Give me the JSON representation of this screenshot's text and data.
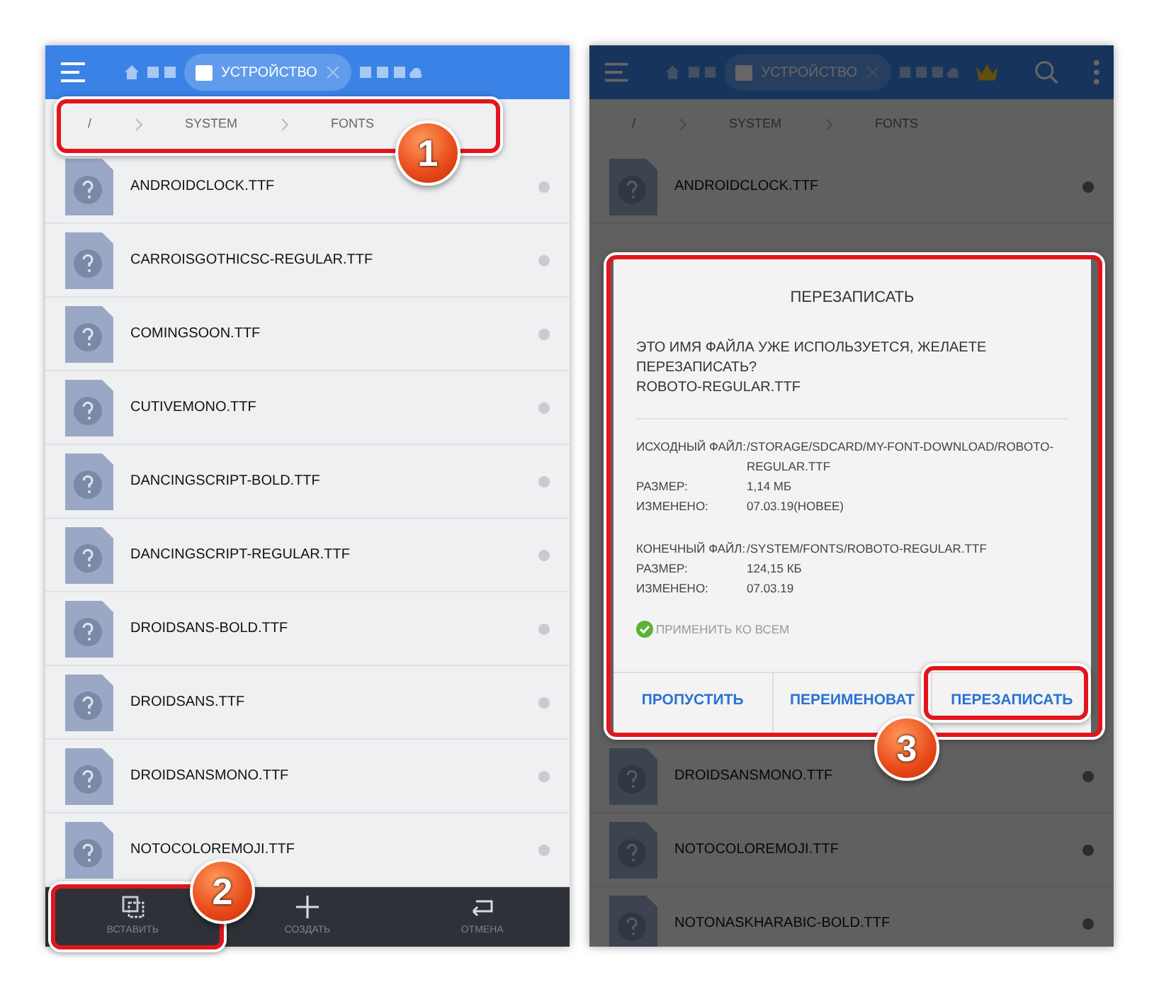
{
  "screens": [
    {
      "dimmed": false,
      "top_bar": {
        "tab": "УСТРОЙСТВО",
        "action_icons": false
      },
      "breadcrumb": [
        "/",
        "SYSTEM",
        "FONTS"
      ],
      "files_above": [
        "ANDROIDCLOCK.TTF",
        "CARROISGOTHICSC-REGULAR.TTF",
        "COMINGSOON.TTF",
        "CUTIVEMONO.TTF",
        "DANCINGSCRIPT-BOLD.TTF",
        "DANCINGSCRIPT-REGULAR.TTF",
        "DROIDSANS-BOLD.TTF",
        "DROIDSANS.TTF",
        "DROIDSANSMONO.TTF",
        "NOTOCOLOREMOJI.TTF"
      ],
      "toolbar": [
        {
          "kind": "paste",
          "label": "ВСТАВИТЬ"
        },
        {
          "kind": "add",
          "label": "СОЗДАТЬ"
        },
        {
          "kind": "undo",
          "label": "ОТМЕНА"
        }
      ]
    },
    {
      "dimmed": true,
      "top_bar": {
        "tab": "УСТРОЙСТВО",
        "action_icons": true
      },
      "breadcrumb": [
        "/",
        "SYSTEM",
        "FONTS"
      ],
      "files_above": [
        "ANDROIDCLOCK.TTF"
      ],
      "files_below": [
        "DROIDSANSMONO.TTF",
        "NOTOCOLOREMOJI.TTF",
        "NOTONASKHARABIC-BOLD.TTF"
      ],
      "dialog": {
        "title": "ПЕРЕЗАПИСАТЬ",
        "message": "ЭТО ИМЯ ФАЙЛА УЖЕ ИСПОЛЬЗУЕТСЯ, ЖЕЛАЕТЕ ПЕРЕЗАПИСАТЬ?",
        "file_name": "ROBOTO-REGULAR.TTF",
        "source": [
          {
            "label": "ИСХОДНЫЙ ФАЙЛ:",
            "value": "/STORAGE/SDCARD/MY-FONT-DOWNLOAD/ROBOTO-REGULAR.TTF"
          },
          {
            "label": "РАЗМЕР:",
            "value": "1,14 МБ"
          },
          {
            "label": "ИЗМЕНЕНО:",
            "value": "07.03.19(НОВЕЕ)"
          }
        ],
        "destination": [
          {
            "label": "КОНЕЧНЫЙ ФАЙЛ:",
            "value": "/SYSTEM/FONTS/ROBOTO-REGULAR.TTF"
          },
          {
            "label": "РАЗМЕР:",
            "value": "124,15 КБ"
          },
          {
            "label": "ИЗМЕНЕНО:",
            "value": "07.03.19"
          }
        ],
        "apply_all": {
          "label": "ПРИМЕНИТЬ КО ВСЕМ",
          "checked": true
        },
        "buttons": [
          "ПРОПУСТИТЬ",
          "ПЕРЕИМЕНОВАТ",
          "ПЕРЕЗАПИСАТЬ"
        ]
      }
    }
  ],
  "callouts": [
    {
      "number": "1"
    },
    {
      "number": "2"
    },
    {
      "number": "3"
    }
  ]
}
